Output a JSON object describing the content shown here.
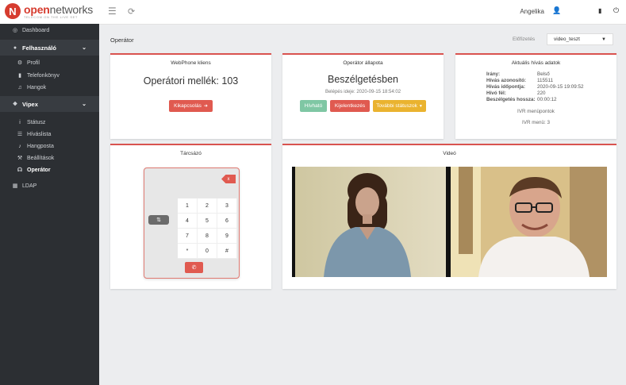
{
  "brand": {
    "name_bold": "open",
    "name_light": "networks",
    "tagline": "TELECOM ON THE LIVE SET"
  },
  "header": {
    "user_name": "Angelika",
    "icons": [
      "menu-icon",
      "refresh-icon",
      "user-icon",
      "book-icon",
      "power-icon"
    ]
  },
  "sidebar": {
    "dashboard": "Dashboard",
    "user_section": "Felhasználó",
    "user_items": [
      {
        "label": "Profil",
        "icon": "gear-icon"
      },
      {
        "label": "Telefonkönyv",
        "icon": "book-icon"
      },
      {
        "label": "Hangok",
        "icon": "music-icon"
      }
    ],
    "vipex_section": "Vipex",
    "vipex_items": [
      {
        "label": "Státusz",
        "icon": "info-icon"
      },
      {
        "label": "Híváslista",
        "icon": "list-icon"
      },
      {
        "label": "Hangposta",
        "icon": "mic-icon"
      },
      {
        "label": "Beállítások",
        "icon": "wrench-icon"
      },
      {
        "label": "Operátor",
        "icon": "headset-icon",
        "active": true
      }
    ],
    "ldap": "LDAP"
  },
  "page": {
    "title": "Operátor",
    "preference_label": "Előfizetés",
    "preference_value": "video_teszt"
  },
  "webphone": {
    "title": "WebPhone kliens",
    "extension": "Operátori mellék: 103",
    "disconnect": "Kikapcsolás"
  },
  "operator_state": {
    "title": "Operátor állapota",
    "state": "Beszélgetésben",
    "login_time": "Belépés ideje: 2020-09-15 18:54:02",
    "btn_available": "Hívható",
    "btn_logout": "Kijelentkezés",
    "btn_more": "További státuszok"
  },
  "current_call": {
    "title": "Aktuális hívás adatok",
    "rows": [
      {
        "k": "Irány:",
        "v": "Belső"
      },
      {
        "k": "Hívás azonosító:",
        "v": "115511"
      },
      {
        "k": "Hívás időpontja:",
        "v": "2020-09-15 19:09:52"
      },
      {
        "k": "Hívó fél:",
        "v": "220"
      },
      {
        "k": "Beszélgetés hossza:",
        "v": "00:00:12"
      }
    ],
    "ivr_points": "IVR menüpontok",
    "ivr_menu": "IVR menü: 3"
  },
  "dialer": {
    "title": "Tárcsázó",
    "backspace": "x",
    "keys": [
      "1",
      "2",
      "3",
      "4",
      "5",
      "6",
      "7",
      "8",
      "9",
      "*",
      "0",
      "#"
    ]
  },
  "video": {
    "title": "Videó"
  }
}
